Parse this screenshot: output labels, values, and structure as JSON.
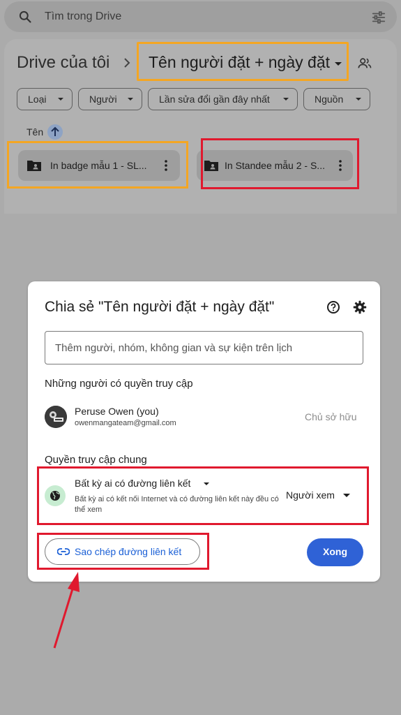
{
  "colors": {
    "highlight_orange": "#f4a623",
    "highlight_red": "#e0192e",
    "primary_blue": "#2f62d6",
    "link_blue": "#1a5fd6",
    "scrim": "#ababab"
  },
  "search": {
    "placeholder": "Tìm trong Drive",
    "icon": "search-icon",
    "filter_icon": "tune-icon"
  },
  "breadcrumb": {
    "root": "Drive của tôi",
    "current": "Tên người đặt + ngày đặt",
    "people_icon": "shared-people-icon"
  },
  "filters": [
    {
      "label": "Loại"
    },
    {
      "label": "Người"
    },
    {
      "label": "Lần sửa đổi gần đây nhất"
    },
    {
      "label": "Nguồn"
    }
  ],
  "sort": {
    "label": "Tên",
    "direction": "ascending"
  },
  "files": [
    {
      "name": "In badge mẫu 1 - SL...",
      "icon": "shared-folder-icon"
    },
    {
      "name": "In Standee mẫu 2 - S...",
      "icon": "shared-folder-icon"
    }
  ],
  "share_dialog": {
    "title": "Chia sẻ \"Tên người đặt + ngày đặt\"",
    "add_placeholder": "Thêm người, nhóm, không gian và sự kiện trên lịch",
    "people_heading": "Những người có quyền truy cập",
    "user": {
      "name": "Peruse Owen (you)",
      "email": "owenmangateam@gmail.com",
      "role": "Chủ sở hữu"
    },
    "general_heading": "Quyền truy cập chung",
    "general_access": {
      "option": "Bất kỳ ai có đường liên kết",
      "description": "Bất kỳ ai có kết nối Internet và có đường liên kết này đều có thể xem",
      "role": "Người xem"
    },
    "copy_link_label": "Sao chép đường liên kết",
    "done_label": "Xong"
  }
}
